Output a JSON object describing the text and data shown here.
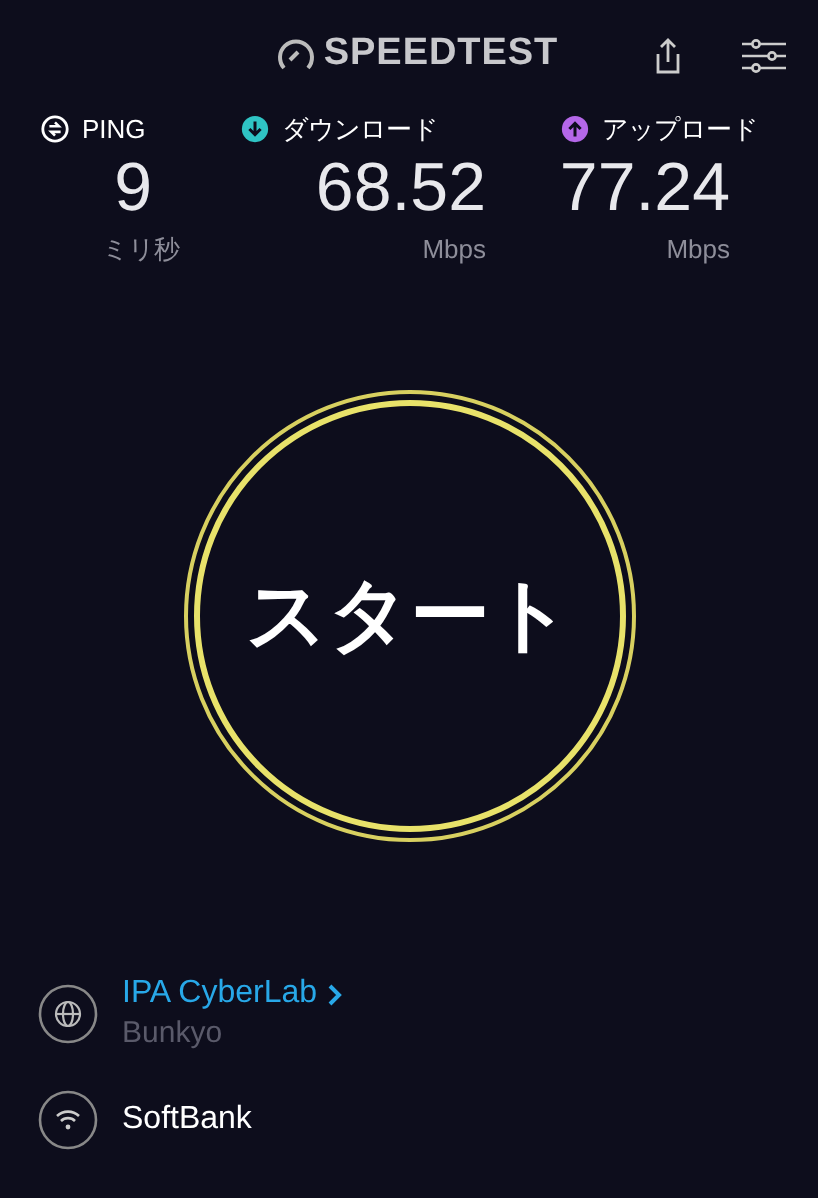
{
  "header": {
    "logo": "SPEEDTEST"
  },
  "metrics": [
    {
      "kind": "ping",
      "label": "PING",
      "value": "9",
      "unit": "ミリ秒"
    },
    {
      "kind": "download",
      "label": "ダウンロード",
      "value": "68.52",
      "unit": "Mbps"
    },
    {
      "kind": "upload",
      "label": "アップロード",
      "value": "77.24",
      "unit": "Mbps"
    }
  ],
  "start_button": {
    "label": "スタート"
  },
  "server": {
    "name": "IPA CyberLab",
    "location": "Bunkyo"
  },
  "network": {
    "provider": "SoftBank"
  }
}
